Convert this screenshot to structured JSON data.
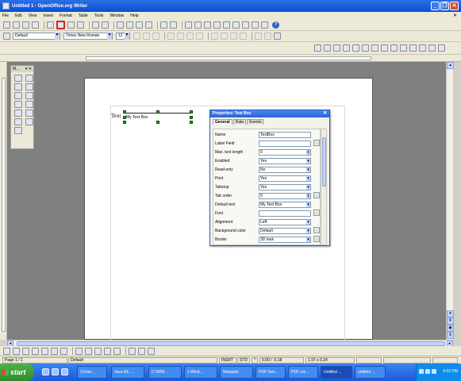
{
  "window": {
    "title": "Untitled 1 - OpenOffice.org Writer"
  },
  "menu": [
    "File",
    "Edit",
    "View",
    "Insert",
    "Format",
    "Table",
    "Tools",
    "Window",
    "Help"
  ],
  "formatting": {
    "style": "Default",
    "font": "Times New Roman",
    "size": "12"
  },
  "form_controls": {
    "title": "M..."
  },
  "document": {
    "label_text": "Text",
    "textbox_text": "My Text Box"
  },
  "properties": {
    "title": "Properties: Text Box",
    "tabs": [
      "General",
      "Data",
      "Events"
    ],
    "rows": [
      {
        "label": "Name",
        "value": "TextBox",
        "kind": "text"
      },
      {
        "label": "Label Field",
        "value": "",
        "kind": "button"
      },
      {
        "label": "Max. text length",
        "value": "0",
        "kind": "spin"
      },
      {
        "label": "Enabled",
        "value": "Yes",
        "kind": "dropdown"
      },
      {
        "label": "Read-only",
        "value": "No",
        "kind": "dropdown"
      },
      {
        "label": "Print",
        "value": "Yes",
        "kind": "dropdown"
      },
      {
        "label": "Tabstop",
        "value": "Yes",
        "kind": "dropdown"
      },
      {
        "label": "Tab order",
        "value": "0",
        "kind": "spin-button"
      },
      {
        "label": "Default text",
        "value": "My Text Box",
        "kind": "dropdown"
      },
      {
        "label": "Font",
        "value": "",
        "kind": "button"
      },
      {
        "label": "Alignment",
        "value": "Left",
        "kind": "dropdown"
      },
      {
        "label": "Background color",
        "value": "Default",
        "kind": "dropdown-button"
      },
      {
        "label": "Border",
        "value": "3D look",
        "kind": "dropdown-button"
      }
    ]
  },
  "status": {
    "page": "Page 1 / 1",
    "style": "Default",
    "mode": "INSRT",
    "selection": "STD",
    "position": "0.00 / -0.18",
    "size": "1.97 x 0.24"
  },
  "taskbar": {
    "start": "start",
    "items": [
      "3 Inter...",
      "Java EE ...",
      "C:\\WIN...",
      "2 Wind...",
      "Notepad...",
      "PDF Gen...",
      "PDF cre...",
      "Untitled ...",
      "untitled ..."
    ],
    "active_index": 7,
    "clock": "6:02 PM"
  },
  "colors": {
    "titlebar": "#0a4fd1",
    "taskbar": "#245edb",
    "start_button": "#3c9d37",
    "handles": "#1f9d1f",
    "highlight_box": "#d52222"
  }
}
